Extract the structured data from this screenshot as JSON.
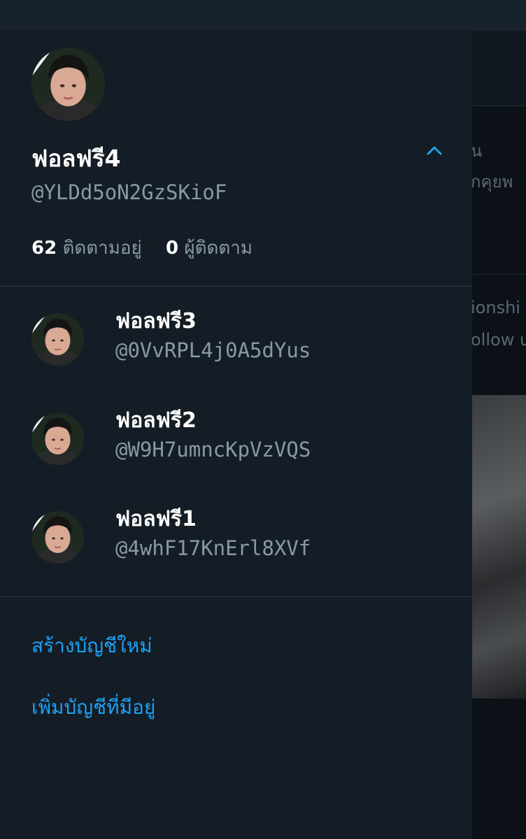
{
  "colors": {
    "drawer_background": "#141d26",
    "primary_text": "#ffffff",
    "secondary_text": "#8899a6",
    "accent": "#1da1f2",
    "divider": "#2f3b47"
  },
  "background_app": {
    "text_fragments": [
      "น",
      "กคุยพ",
      "ionshi",
      "ollow u"
    ]
  },
  "profile": {
    "display_name": "ฟอลฟรี4",
    "handle": "@YLDd5oN2GzSKioF",
    "following_count": "62",
    "following_label": "ติดตามอยู่",
    "followers_count": "0",
    "followers_label": "ผู้ติดตาม",
    "toggle_icon": "chevron-up-icon"
  },
  "accounts": [
    {
      "name": "ฟอลฟรี3",
      "handle": "@0VvRPL4j0A5dYus"
    },
    {
      "name": "ฟอลฟรี2",
      "handle": "@W9H7umncKpVzVQS"
    },
    {
      "name": "ฟอลฟรี1",
      "handle": "@4whF17KnErl8XVf"
    }
  ],
  "actions": {
    "create_account": "สร้างบัญชีใหม่",
    "add_existing_account": "เพิ่มบัญชีที่มีอยู่"
  }
}
